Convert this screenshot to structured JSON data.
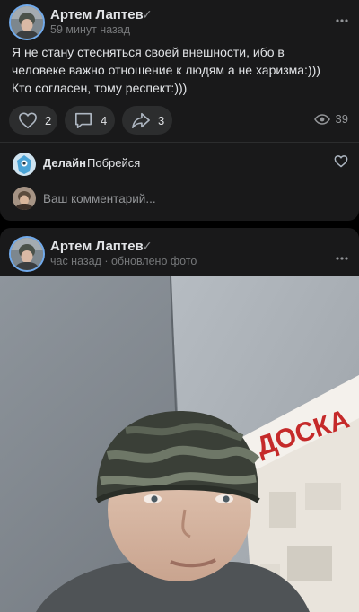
{
  "post1": {
    "author": "Артем Лаптев",
    "time": "59 минут назад",
    "text_line1": "Я не стану стесняться своей внешности, ибо в",
    "text_line2": "человеке важно отношение к людям а не харизма:)))",
    "text_line3": "Кто согласен, тому респект:)))",
    "likes": "2",
    "comments": "4",
    "shares": "3",
    "views": "39",
    "comment": {
      "author": "Делайн",
      "text": "Побрейся"
    },
    "comment_placeholder": "Ваш комментарий..."
  },
  "post2": {
    "author": "Артем Лаптев",
    "time": "час назад · обновлено фото",
    "photo_sign_text": "ДОСКА"
  },
  "colors": {
    "background": "#000000",
    "card": "#19191a",
    "pill": "#2c2d2e",
    "text": "#e1e3e6",
    "muted": "#76787a",
    "avatar_ring": "#71aaeb"
  },
  "icons": [
    "verified-icon",
    "more-icon",
    "like-icon",
    "comment-icon",
    "share-icon",
    "views-icon",
    "heart-icon"
  ]
}
